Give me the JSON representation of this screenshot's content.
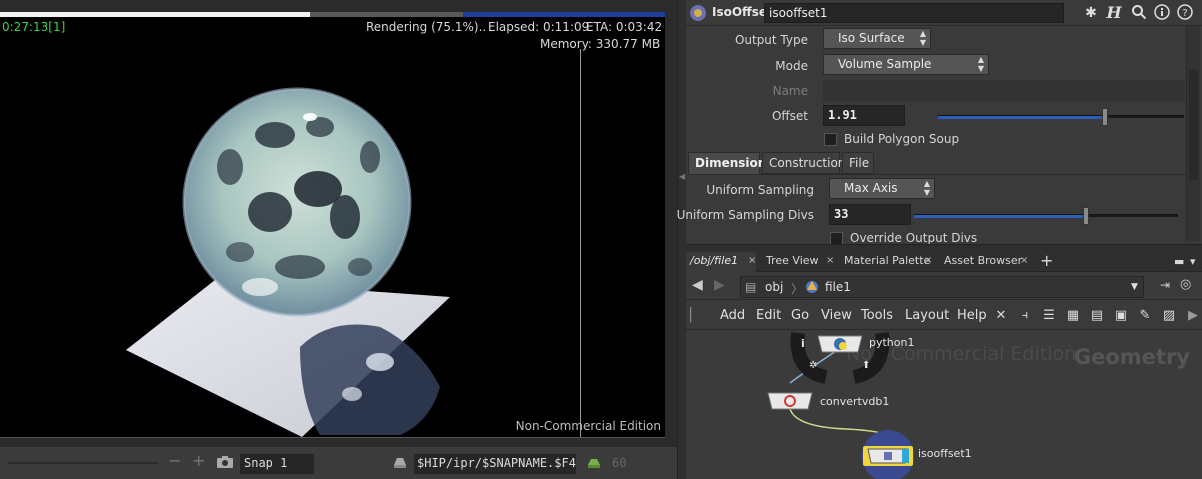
{
  "render": {
    "progress": 0.751,
    "time_code": "0:27:13[1]",
    "status": "Rendering (75.1%)..",
    "elapsed": "Elapsed: 0:11:09",
    "eta": "ETA: 0:03:42",
    "memory": "Memory:   330.77 MB",
    "watermark": "Non-Commercial Edition",
    "footer": {
      "minus": "−",
      "plus": "+",
      "snap_name": "Snap 1",
      "output_path": "$HIP/ipr/$SNAPNAME.$F4",
      "frames": "60"
    }
  },
  "params": {
    "node_type": "IsoOffset",
    "node_name": "isooffset1",
    "output_type": {
      "label": "Output Type",
      "value": "Iso Surface"
    },
    "mode": {
      "label": "Mode",
      "value": "Volume Sample"
    },
    "name": {
      "label": "Name",
      "value": ""
    },
    "offset": {
      "label": "Offset",
      "value": "1.91",
      "slider": 0.68
    },
    "build_polygon_soup": {
      "label": "Build Polygon Soup",
      "checked": false
    },
    "tabs": [
      "Dimensions",
      "Construction",
      "File"
    ],
    "active_tab": "Dimensions",
    "uniform_sampling": {
      "label": "Uniform Sampling",
      "value": "Max Axis"
    },
    "uniform_sampling_divs": {
      "label": "Uniform Sampling Divs",
      "value": "33",
      "slider": 0.65
    },
    "override_output_divs": {
      "label": "Override Output Divs",
      "checked": false
    }
  },
  "network": {
    "tabs": [
      {
        "label": "/obj/file1",
        "active": true
      },
      {
        "label": "Tree View"
      },
      {
        "label": "Material Palette"
      },
      {
        "label": "Asset Browser"
      }
    ],
    "add_tab": "+",
    "path": [
      "obj",
      "file1"
    ],
    "menu": [
      "Add",
      "Edit",
      "Go",
      "View",
      "Tools",
      "Layout",
      "Help"
    ],
    "watermark": "Non-Commercial Edition",
    "context_label": "Geometry",
    "nodes": [
      {
        "name": "python1",
        "icon": "python-icon"
      },
      {
        "name": "convertvdb1",
        "icon": "vdb-icon"
      },
      {
        "name": "isooffset1",
        "icon": "isooffset-icon",
        "selected": true
      }
    ]
  },
  "colors": {
    "accent_blue": "#2b5fb8",
    "selected_node": "#f2d640",
    "time_green": "#3fd14c"
  }
}
